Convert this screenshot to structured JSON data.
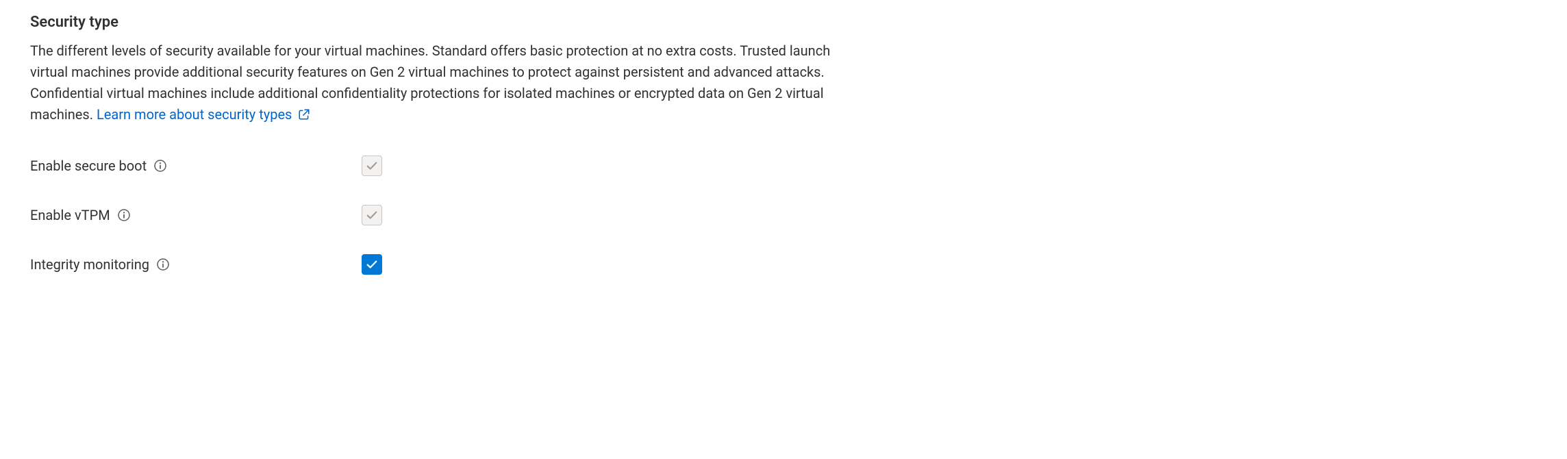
{
  "section": {
    "heading": "Security type",
    "description": "The different levels of security available for your virtual machines. Standard offers basic protection at no extra costs. Trusted launch virtual machines provide additional security features on Gen 2 virtual machines to protect against persistent and advanced attacks. Confidential virtual machines include additional confidentiality protections for isolated machines or encrypted data on Gen 2 virtual machines. ",
    "link_text": "Learn more about security types"
  },
  "fields": {
    "secureBoot": {
      "label": "Enable secure boot",
      "checked": true,
      "disabled": true
    },
    "vtpm": {
      "label": "Enable vTPM",
      "checked": true,
      "disabled": true
    },
    "integrity": {
      "label": "Integrity monitoring",
      "checked": true,
      "disabled": false
    }
  }
}
